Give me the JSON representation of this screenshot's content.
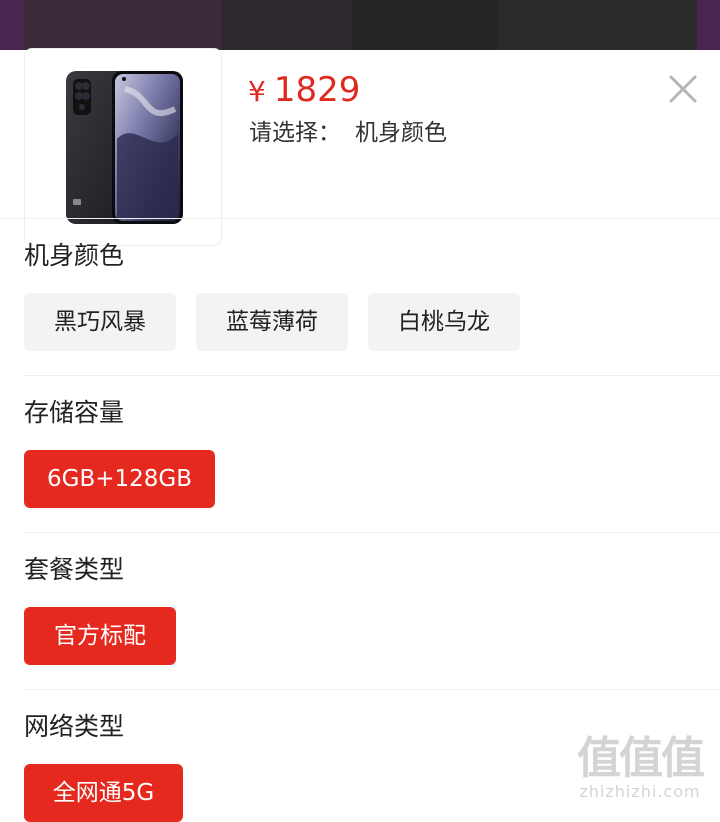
{
  "product": {
    "currency_symbol": "¥",
    "price": "1829",
    "select_label": "请选择：",
    "select_value": "机身颜色"
  },
  "sections": [
    {
      "title": "机身颜色",
      "options": [
        {
          "label": "黑巧风暴",
          "selected": false
        },
        {
          "label": "蓝莓薄荷",
          "selected": false
        },
        {
          "label": "白桃乌龙",
          "selected": false
        }
      ]
    },
    {
      "title": "存储容量",
      "options": [
        {
          "label": "6GB+128GB",
          "selected": true
        }
      ]
    },
    {
      "title": "套餐类型",
      "options": [
        {
          "label": "官方标配",
          "selected": true
        }
      ]
    },
    {
      "title": "网络类型",
      "options": [
        {
          "label": "全网通5G",
          "selected": true
        }
      ]
    }
  ],
  "watermark": {
    "main": "值值值",
    "sub": "zhizhizhi.com"
  },
  "colors": {
    "accent": "#e6291f",
    "price": "#e02a20",
    "chip_bg": "#f3f3f3"
  },
  "icons": {
    "close": "close-icon"
  }
}
